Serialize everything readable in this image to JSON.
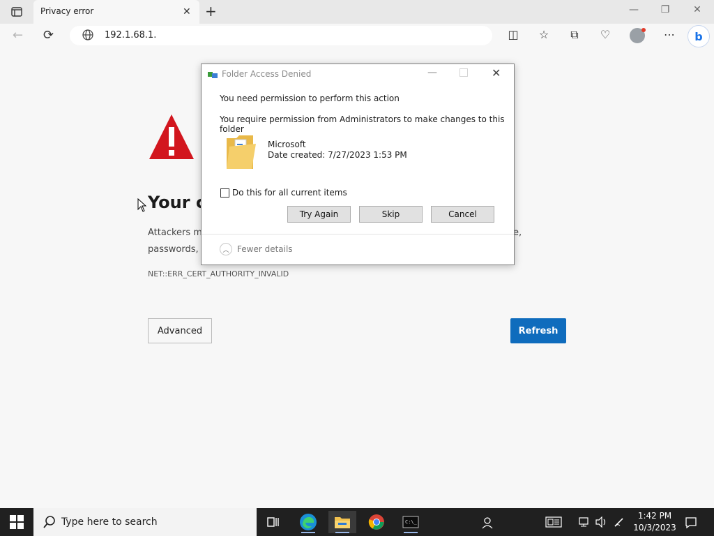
{
  "browser": {
    "tab_title": "Privacy error",
    "url": "192.1.68.1.",
    "tab_close_glyph": "✕",
    "new_tab_glyph": "+"
  },
  "page": {
    "heading": "Your co",
    "para_line1": "Attackers mi",
    "para_line2": "passwords, n",
    "para_tail": "e,",
    "error_code": "NET::ERR_CERT_AUTHORITY_INVALID",
    "advanced_label": "Advanced",
    "refresh_label": "Refresh"
  },
  "dialog": {
    "title": "Folder Access Denied",
    "line1": "You need permission to perform this action",
    "line2": "You require permission from Administrators to make changes to this folder",
    "item_name": "Microsoft",
    "item_date": "Date created: 7/27/2023 1:53 PM",
    "checkbox_label": "Do this for all current items",
    "try_again_label": "Try Again",
    "skip_label": "Skip",
    "cancel_label": "Cancel",
    "fewer_details_label": "Fewer details"
  },
  "taskbar": {
    "search_text": "Type here to search",
    "time": "1:42 PM",
    "date": "10/3/2023"
  },
  "colors": {
    "accent_blue": "#0f6cbd",
    "warning_red": "#d2161e",
    "taskbar": "#202020"
  }
}
